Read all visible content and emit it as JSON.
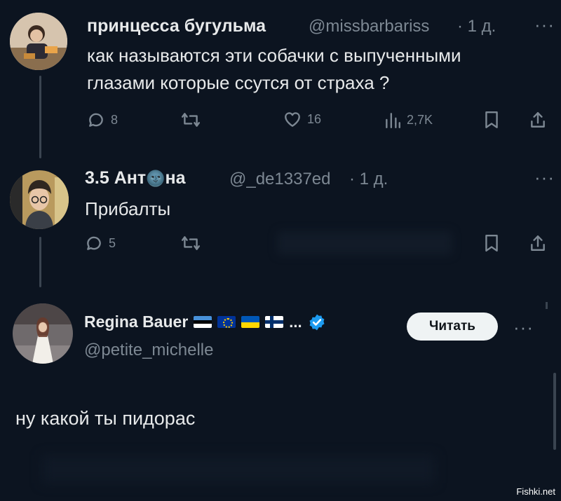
{
  "tweet1": {
    "name": "принцесса бугульма",
    "handle": "@missbarbariss",
    "time": "· 1 д.",
    "more": "···",
    "line1": "как называются эти собачки с выпученными",
    "line2": "глазами которые ссутся от страха ?",
    "replies": "8",
    "likes": "16",
    "views": "2,7K"
  },
  "tweet2": {
    "name_part1": "3.5 Ант",
    "moon_emoji": "🌚",
    "name_part2": "на",
    "handle": "@_de1337ed",
    "time": "· 1 д.",
    "more": "···",
    "text": "Прибалты",
    "replies": "5"
  },
  "tweet3": {
    "name": "Regina Bauer",
    "flags": [
      "estonia",
      "eu",
      "ukraine",
      "finland"
    ],
    "ellipsis": "...",
    "handle": "@petite_michelle",
    "follow_label": "Читать",
    "more": "···",
    "text": "ну какой ты пидорас"
  },
  "watermark": "Fishki.net",
  "colors": {
    "background": "#0c1420",
    "text": "#e7e9ea",
    "muted": "#7d8893",
    "verified": "#1d9bf0",
    "follow_bg": "#eff3f4"
  }
}
